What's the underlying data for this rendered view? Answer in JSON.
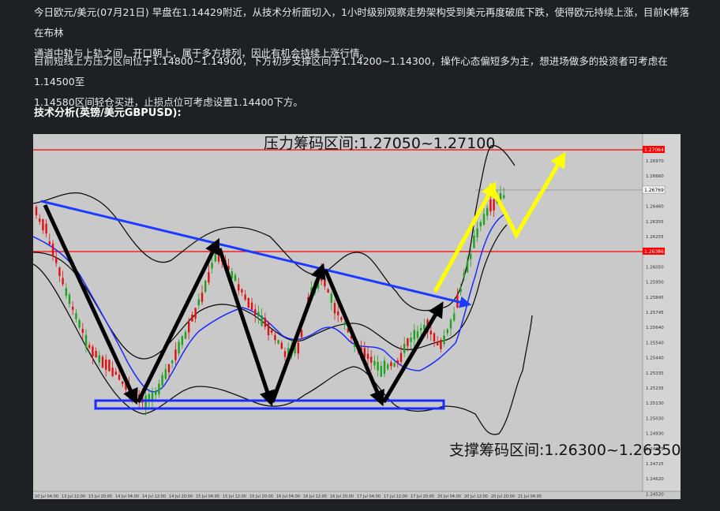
{
  "article": {
    "paragraph1_line1": "今日欧元/美元(07月21日) 早盘在1.14429附近，从技术分析面切入，1小时级别观察走势架构受到美元再度破底下跌，使得欧元持续上涨，目前K棒落在布林",
    "paragraph1_line2": "通道中轨与上轨之间，开口朝上，属于多方排列，因此有机会持续上涨行情。",
    "paragraph2_line1": "目前短线上方压力区间位于1.14800~1.14900，下方初步支撑区间于1.14200~1.14300，操作心态偏短多为主，想进场做多的投资者可考虑在1.14500至",
    "paragraph2_line2": "1.14580区间轻仓买进，止损点位可考虑设置1.14400下方。",
    "section_title": "技术分析(英镑/美元GBPUSD):"
  },
  "chart_data": {
    "type": "candlestick",
    "symbol": "GBPUSD",
    "resistance_label": "压力筹码区间:1.27050~1.27100",
    "support_label": "支撑筹码区间:1.26300~1.26350",
    "price_axis": [
      "1.26970",
      "1.26660",
      "1.26560",
      "1.26460",
      "1.26355",
      "1.26255",
      "1.26150",
      "1.26050",
      "1.25950",
      "1.25845",
      "1.25745",
      "1.25640",
      "1.25540",
      "1.25440",
      "1.25335",
      "1.25235",
      "1.25130",
      "1.25030",
      "1.24930",
      "1.24825",
      "1.24725",
      "1.24620",
      "1.24520"
    ],
    "price_tags": {
      "top": "1.27064",
      "current": "1.26769",
      "mid": "1.26386"
    },
    "time_axis": [
      "10 Jul 04:00",
      "13 Jul 12:00",
      "13 Jul 20:00",
      "14 Jul 04:00",
      "14 Jul 12:00",
      "14 Jul 20:00",
      "15 Jul 04:00",
      "15 Jul 12:00",
      "15 Jul 20:00",
      "16 Jul 04:00",
      "16 Jul 12:00",
      "16 Jul 20:00",
      "17 Jul 04:00",
      "17 Jul 12:00",
      "17 Jul 20:00",
      "20 Jul 04:00",
      "20 Jul 12:00",
      "20 Jul 20:00",
      "21 Jul 04:00"
    ],
    "colors": {
      "bull": "#1fa31f",
      "bear": "#e01010",
      "ma": "#1a2bff",
      "band": "#111111",
      "resistance": "#ff0000",
      "arrow_black": "#000000",
      "arrow_yellow": "#ffff00",
      "trend": "#1a3bff"
    }
  }
}
